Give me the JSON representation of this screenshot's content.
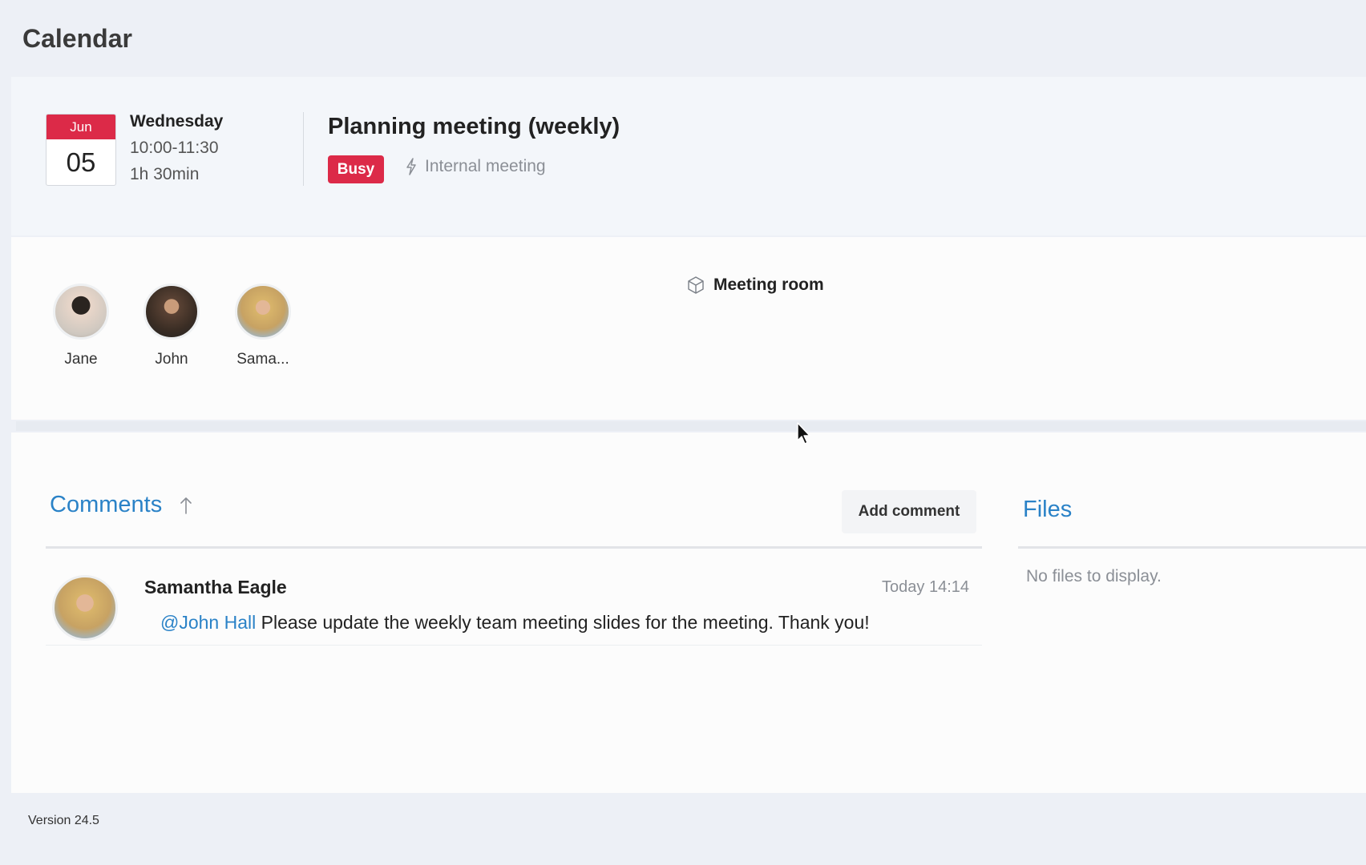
{
  "app": {
    "title": "Calendar"
  },
  "event": {
    "month": "Jun",
    "day": "05",
    "weekday": "Wednesday",
    "time_range": "10:00-11:30",
    "duration": "1h 30min",
    "title": "Planning meeting (weekly)",
    "status": "Busy",
    "type_icon": "lightning-icon",
    "type": "Internal meeting",
    "location_icon": "cube-icon",
    "location": "Meeting room"
  },
  "attendees": [
    {
      "name": "Jane"
    },
    {
      "name": "John"
    },
    {
      "name": "Sama..."
    }
  ],
  "comments": {
    "title": "Comments",
    "sort_icon": "arrow-up-icon",
    "add_label": "Add comment",
    "items": [
      {
        "author": "Samantha Eagle",
        "time": "Today 14:14",
        "mention": "@John Hall",
        "text": " Please update the weekly team meeting slides for the meeting. Thank you!"
      }
    ]
  },
  "files": {
    "title": "Files",
    "empty_text": "No files to display."
  },
  "footer": {
    "version": "Version 24.5"
  },
  "colors": {
    "accent_red": "#dc2a48",
    "link_blue": "#2a82c7"
  }
}
